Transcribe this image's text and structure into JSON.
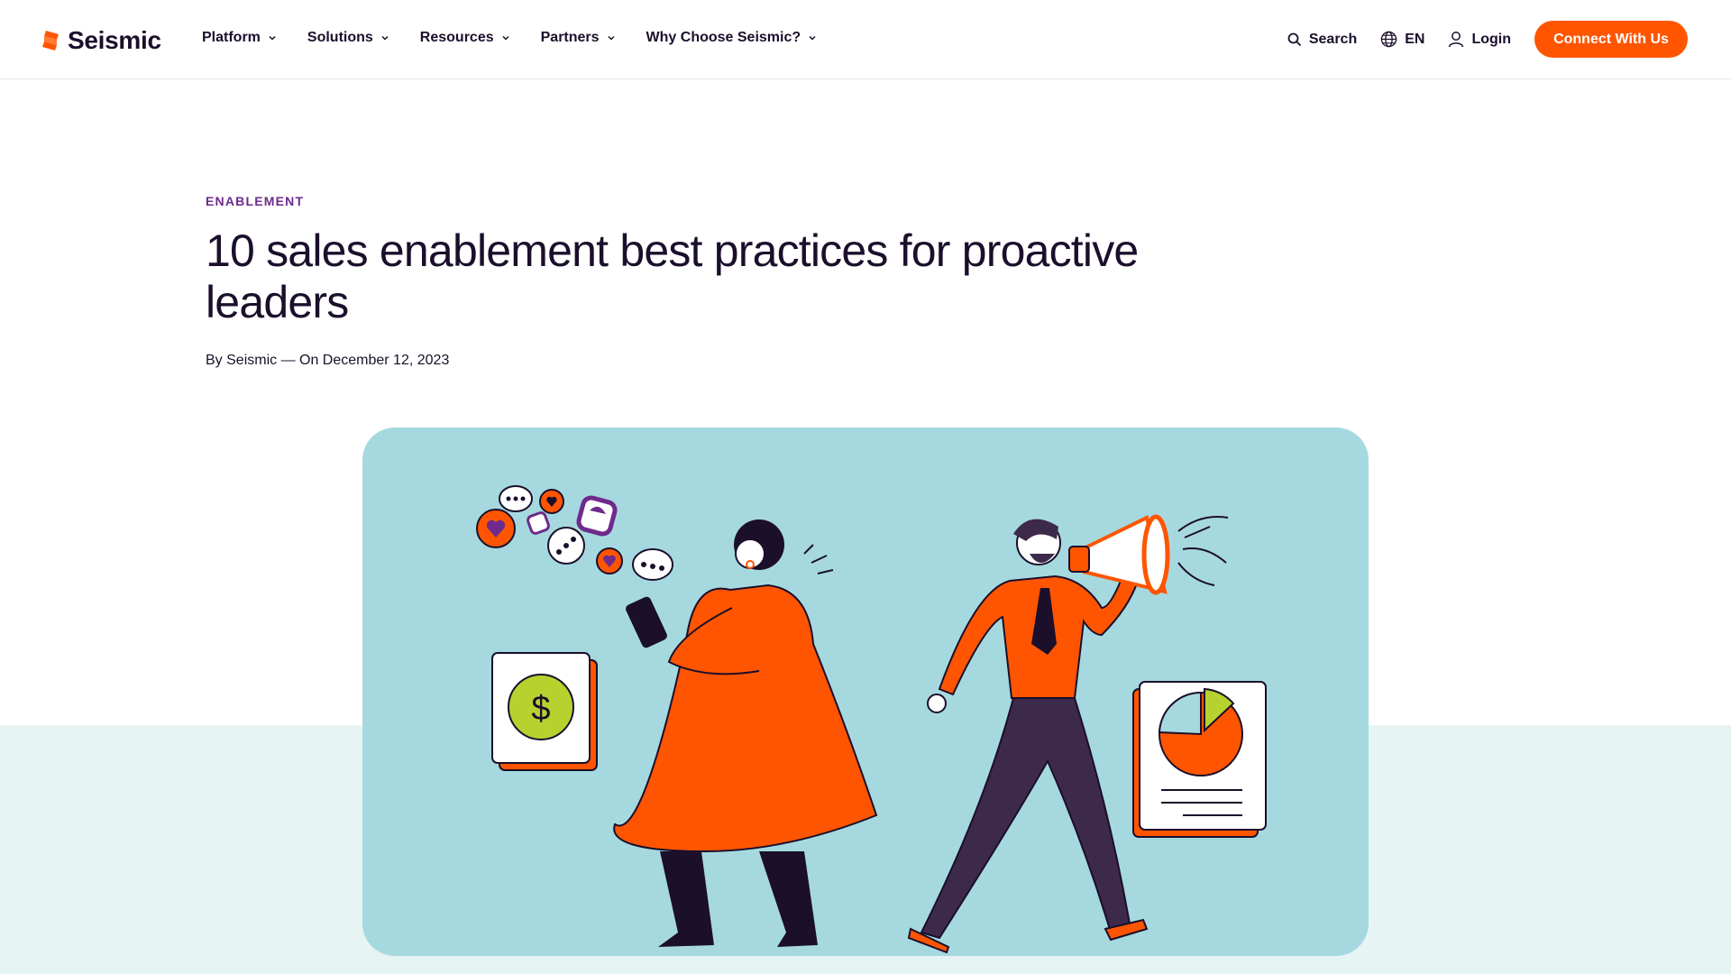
{
  "brand": {
    "name": "Seismic",
    "accent_color": "#ff5500",
    "category_color": "#6e2a8c",
    "illustration_bg": "#a6d9df"
  },
  "nav": {
    "items": [
      {
        "label": "Platform"
      },
      {
        "label": "Solutions"
      },
      {
        "label": "Resources"
      },
      {
        "label": "Partners"
      },
      {
        "label": "Why Choose Seismic?"
      }
    ],
    "search_label": "Search",
    "language_label": "EN",
    "login_label": "Login",
    "cta_label": "Connect With Us"
  },
  "article": {
    "category": "ENABLEMENT",
    "title": "10 sales enablement best practices for proactive leaders",
    "byline": "By Seismic — On December 12, 2023"
  },
  "hero": {
    "icons": [
      "dollar-icon",
      "pie-chart-icon",
      "megaphone-icon",
      "chat-bubble-icon",
      "heart-icon"
    ]
  }
}
